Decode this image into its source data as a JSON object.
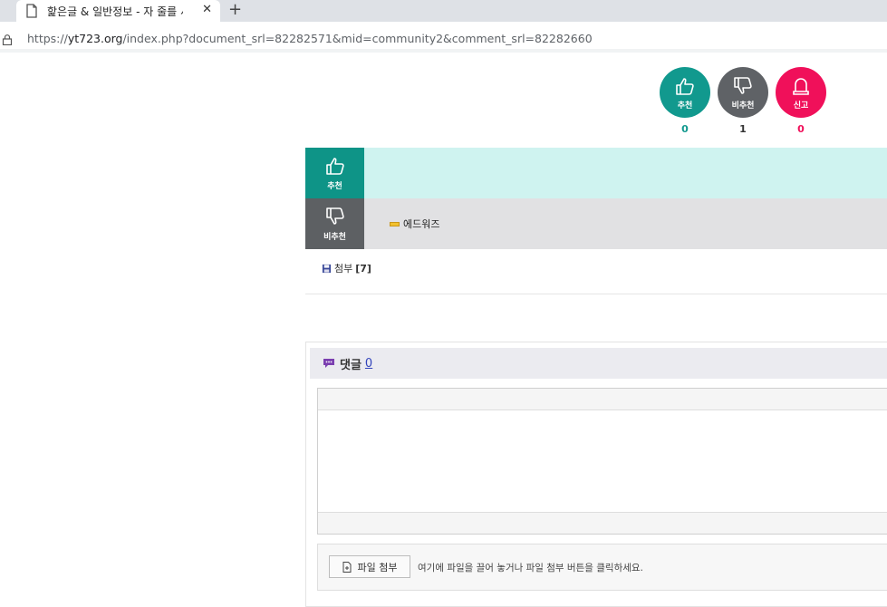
{
  "browser": {
    "tab_title": "핥은글 & 일반정보 - 자 줄를 서시",
    "tab_close": "✕",
    "new_tab": "+",
    "url_scheme": "https://",
    "url_host": "yt723.org",
    "url_path": "/index.php?document_srl=82282571&mid=community2&comment_srl=82282660"
  },
  "votes": [
    {
      "label": "추천",
      "count": "0",
      "color": "#11998e",
      "count_color": "#11998e"
    },
    {
      "label": "비추천",
      "count": "1",
      "color": "#5f6266",
      "count_color": "#333333"
    },
    {
      "label": "신고",
      "count": "0",
      "color": "#f0105a",
      "count_color": "#f0105a"
    }
  ],
  "rows": {
    "recommend": {
      "label": "추천",
      "icon_bg": "#0e9487",
      "row_bg": "#cff3f0"
    },
    "not_recommend": {
      "label": "비추천",
      "icon_bg": "#5d6063",
      "row_bg": "#e1e1e3",
      "user": "에드워즈"
    }
  },
  "attachment": {
    "label": "첨부",
    "count": "[7]"
  },
  "comments": {
    "title": "댓글",
    "count": "0",
    "upload_button": "파일 첨부",
    "upload_hint": "여기에 파일을 끌어 놓거나 파일 첨부 버튼을 클릭하세요."
  }
}
